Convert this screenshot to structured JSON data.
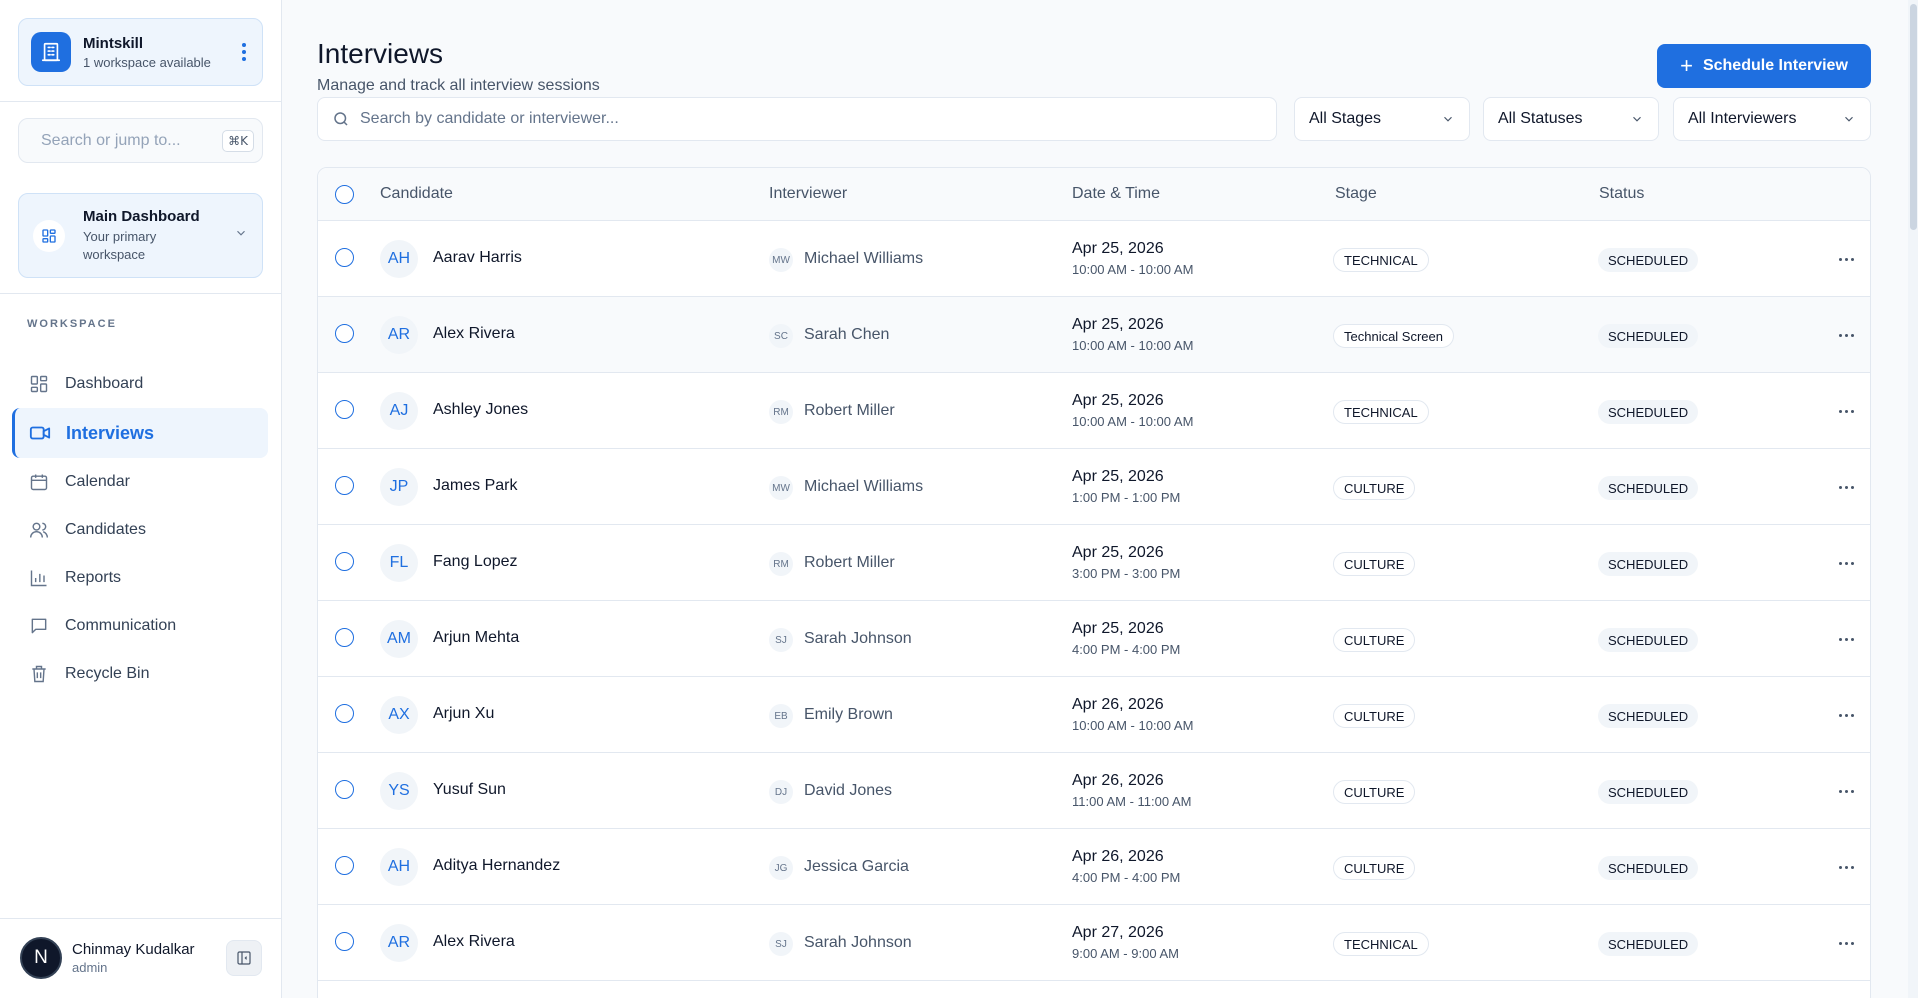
{
  "workspace": {
    "name": "Mintskill",
    "sub": "1 workspace available"
  },
  "jump": {
    "placeholder": "Search or jump to...",
    "shortcut": "⌘K"
  },
  "dashboard_switch": {
    "title": "Main Dashboard",
    "sub": "Your primary workspace"
  },
  "nav": {
    "section_label": "WORKSPACE",
    "items": [
      {
        "label": "Dashboard",
        "icon": "dashboard-icon"
      },
      {
        "label": "Interviews",
        "icon": "video-icon",
        "active": true
      },
      {
        "label": "Calendar",
        "icon": "calendar-icon"
      },
      {
        "label": "Candidates",
        "icon": "users-icon"
      },
      {
        "label": "Reports",
        "icon": "bar-chart-icon"
      },
      {
        "label": "Communication",
        "icon": "message-icon"
      },
      {
        "label": "Recycle Bin",
        "icon": "trash-icon"
      }
    ]
  },
  "user": {
    "initial": "N",
    "name": "Chinmay Kudalkar",
    "role": "admin"
  },
  "page": {
    "title": "Interviews",
    "subtitle": "Manage and track all interview sessions",
    "schedule_label": "Schedule Interview"
  },
  "search": {
    "placeholder": "Search by candidate or interviewer..."
  },
  "filters": {
    "stages": "All Stages",
    "statuses": "All Statuses",
    "interviewers": "All Interviewers"
  },
  "table": {
    "headers": {
      "candidate": "Candidate",
      "interviewer": "Interviewer",
      "datetime": "Date & Time",
      "stage": "Stage",
      "status": "Status"
    },
    "rows": [
      {
        "initials": "AH",
        "candidate": "Aarav Harris",
        "int_initials": "MW",
        "interviewer": "Michael Williams",
        "date": "Apr 25, 2026",
        "time": "10:00 AM - 10:00 AM",
        "stage": "TECHNICAL",
        "status": "SCHEDULED"
      },
      {
        "initials": "AR",
        "candidate": "Alex Rivera",
        "int_initials": "SC",
        "interviewer": "Sarah Chen",
        "date": "Apr 25, 2026",
        "time": "10:00 AM - 10:00 AM",
        "stage": "Technical Screen",
        "status": "SCHEDULED"
      },
      {
        "initials": "AJ",
        "candidate": "Ashley Jones",
        "int_initials": "RM",
        "interviewer": "Robert Miller",
        "date": "Apr 25, 2026",
        "time": "10:00 AM - 10:00 AM",
        "stage": "TECHNICAL",
        "status": "SCHEDULED"
      },
      {
        "initials": "JP",
        "candidate": "James Park",
        "int_initials": "MW",
        "interviewer": "Michael Williams",
        "date": "Apr 25, 2026",
        "time": "1:00 PM - 1:00 PM",
        "stage": "CULTURE",
        "status": "SCHEDULED"
      },
      {
        "initials": "FL",
        "candidate": "Fang Lopez",
        "int_initials": "RM",
        "interviewer": "Robert Miller",
        "date": "Apr 25, 2026",
        "time": "3:00 PM - 3:00 PM",
        "stage": "CULTURE",
        "status": "SCHEDULED"
      },
      {
        "initials": "AM",
        "candidate": "Arjun Mehta",
        "int_initials": "SJ",
        "interviewer": "Sarah Johnson",
        "date": "Apr 25, 2026",
        "time": "4:00 PM - 4:00 PM",
        "stage": "CULTURE",
        "status": "SCHEDULED"
      },
      {
        "initials": "AX",
        "candidate": "Arjun Xu",
        "int_initials": "EB",
        "interviewer": "Emily Brown",
        "date": "Apr 26, 2026",
        "time": "10:00 AM - 10:00 AM",
        "stage": "CULTURE",
        "status": "SCHEDULED"
      },
      {
        "initials": "YS",
        "candidate": "Yusuf Sun",
        "int_initials": "DJ",
        "interviewer": "David Jones",
        "date": "Apr 26, 2026",
        "time": "11:00 AM - 11:00 AM",
        "stage": "CULTURE",
        "status": "SCHEDULED"
      },
      {
        "initials": "AH",
        "candidate": "Aditya Hernandez",
        "int_initials": "JG",
        "interviewer": "Jessica Garcia",
        "date": "Apr 26, 2026",
        "time": "4:00 PM - 4:00 PM",
        "stage": "CULTURE",
        "status": "SCHEDULED"
      },
      {
        "initials": "AR",
        "candidate": "Alex Rivera",
        "int_initials": "SJ",
        "interviewer": "Sarah Johnson",
        "date": "Apr 27, 2026",
        "time": "9:00 AM - 9:00 AM",
        "stage": "TECHNICAL",
        "status": "SCHEDULED"
      }
    ]
  },
  "colors": {
    "accent": "#1f6fe0",
    "accent_soft": "#eef5fd",
    "border": "#e2e8f0"
  }
}
